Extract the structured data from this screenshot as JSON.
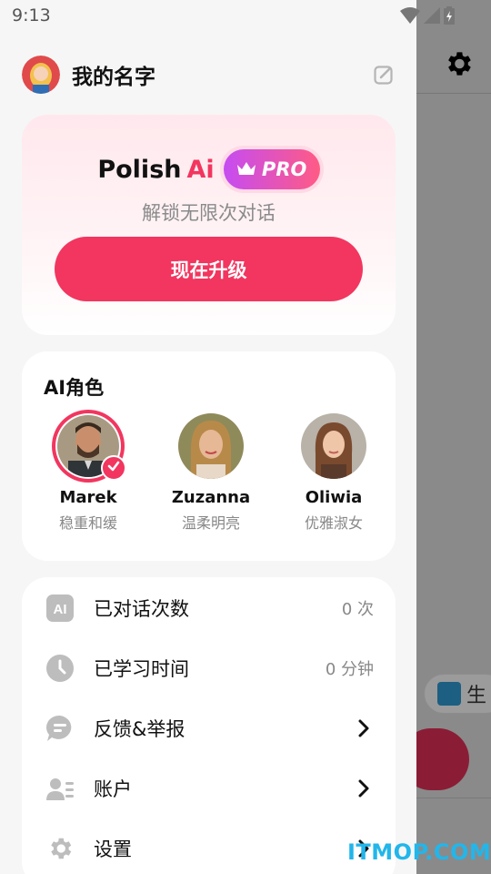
{
  "status_bar": {
    "time": "9:13"
  },
  "profile": {
    "name": "我的名字"
  },
  "pro_card": {
    "title": "Polish",
    "title_accent": "Ai",
    "badge": "PRO",
    "subtitle": "解锁无限次对话",
    "upgrade_label": "现在升级"
  },
  "roles": {
    "title": "AI角色",
    "items": [
      {
        "name": "Marek",
        "desc": "稳重和缓",
        "selected": true
      },
      {
        "name": "Zuzanna",
        "desc": "温柔明亮",
        "selected": false
      },
      {
        "name": "Oliwia",
        "desc": "优雅淑女",
        "selected": false
      }
    ]
  },
  "menu": {
    "items": [
      {
        "label": "已对话次数",
        "value": "0 次",
        "icon": "ai-icon"
      },
      {
        "label": "已学习时间",
        "value": "0 分钟",
        "icon": "clock-icon"
      },
      {
        "label": "反馈&举报",
        "icon": "feedback-icon"
      },
      {
        "label": "账户",
        "icon": "account-icon"
      },
      {
        "label": "设置",
        "icon": "gear-icon"
      }
    ]
  },
  "background": {
    "chip_text": "生"
  },
  "watermark": "ITMOP.COM",
  "colors": {
    "accent": "#f2365f",
    "badge_gradient_start": "#c54cf2",
    "badge_gradient_end": "#ff5b85"
  }
}
